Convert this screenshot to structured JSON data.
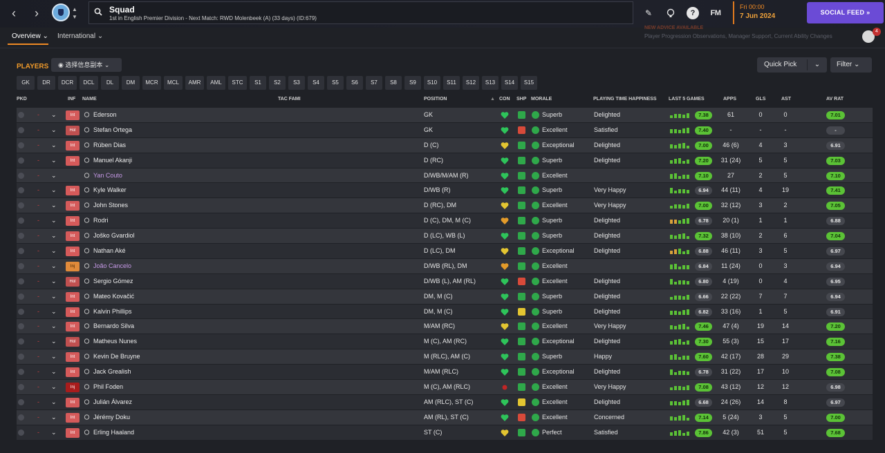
{
  "topbar": {
    "back_label": "‹",
    "forward_label": "›",
    "search_title": "Squad",
    "search_subtitle": "1st in English Premier Division - Next Match: RWD Molenbeek (A) (33 days) (ID:679)",
    "fm_label": "FM",
    "help_label": "?",
    "time": "Fri 00:00",
    "date": "7 Jun 2024",
    "social_feed_label": "SOCIAL FEED »",
    "accent": "#f08a24",
    "social_color": "#6b4bd6"
  },
  "subbar": {
    "tabs": [
      {
        "label": "Overview ⌄"
      },
      {
        "label": "International ⌄"
      }
    ],
    "advice_title": "NEW ADVICE AVAILABLE",
    "advice_line": "Player Progression Observations, Manager Support, Current Ability Changes",
    "advisor_count": "4"
  },
  "players": {
    "label": "PLAYERS",
    "view_label": "◉ 选择信息副本 ⌄",
    "quick_pick_label": "Quick Pick",
    "quick_pick_chevron": "⌄",
    "filter_label": "Filter ⌄",
    "positions": [
      "GK",
      "DR",
      "DCR",
      "DCL",
      "DL",
      "DM",
      "MCR",
      "MCL",
      "AMR",
      "AML",
      "STC",
      "S1",
      "S2",
      "S3",
      "S4",
      "S5",
      "S6",
      "S7",
      "S8",
      "S9",
      "S10",
      "S11",
      "S12",
      "S13",
      "S14",
      "S15"
    ]
  },
  "table": {
    "headers": {
      "pkd": "PKD",
      "inf": "INF",
      "name": "NAME",
      "tac": "TAC FAMI",
      "position": "POSITION",
      "con": "CON",
      "shp": "SHP",
      "morale": "MORALE",
      "pth": "PLAYING TIME HAPPINESS",
      "last5": "LAST 5 GAMES",
      "apps": "APPS",
      "gls": "GLS",
      "ast": "AST",
      "avrat": "AV RAT"
    },
    "rows": [
      {
        "inf": "Int",
        "name": "Ederson",
        "pos": "GK",
        "morale": "Superb",
        "pth": "Delighted",
        "l5": "7.38",
        "apps": "61",
        "gls": "0",
        "ast": "0",
        "av": "7.01"
      },
      {
        "inf": "Hol",
        "name": "Stefan Ortega",
        "pos": "GK",
        "morale": "Excellent",
        "pth": "Satisfied",
        "l5": "7.40",
        "apps": "-",
        "gls": "-",
        "ast": "-",
        "av": "-"
      },
      {
        "inf": "Int",
        "name": "Rúben Dias",
        "pos": "D (C)",
        "morale": "Exceptional",
        "pth": "Delighted",
        "l5": "7.00",
        "apps": "46 (6)",
        "gls": "4",
        "ast": "3",
        "av": "6.91"
      },
      {
        "inf": "Int",
        "name": "Manuel Akanji",
        "pos": "D (RC)",
        "morale": "Superb",
        "pth": "Delighted",
        "l5": "7.20",
        "apps": "31 (24)",
        "gls": "5",
        "ast": "5",
        "av": "7.03"
      },
      {
        "inf": "",
        "name": "Yan Couto",
        "pos": "D/WB/M/AM (R)",
        "morale": "Excellent",
        "pth": "",
        "l5": "7.10",
        "apps": "27",
        "gls": "2",
        "ast": "5",
        "av": "7.10"
      },
      {
        "inf": "Int",
        "name": "Kyle Walker",
        "pos": "D/WB (R)",
        "morale": "Superb",
        "pth": "Very Happy",
        "l5": "6.94",
        "apps": "44 (11)",
        "gls": "4",
        "ast": "19",
        "av": "7.41"
      },
      {
        "inf": "Int",
        "name": "John Stones",
        "pos": "D (RC), DM",
        "morale": "Excellent",
        "pth": "Very Happy",
        "l5": "7.00",
        "apps": "32 (12)",
        "gls": "3",
        "ast": "2",
        "av": "7.05"
      },
      {
        "inf": "Int",
        "name": "Rodri",
        "pos": "D (C), DM, M (C)",
        "morale": "Superb",
        "pth": "Delighted",
        "l5": "6.78",
        "apps": "20 (1)",
        "gls": "1",
        "ast": "1",
        "av": "6.88"
      },
      {
        "inf": "Int",
        "name": "Joško Gvardiol",
        "pos": "D (LC), WB (L)",
        "morale": "Superb",
        "pth": "Delighted",
        "l5": "7.32",
        "apps": "38 (10)",
        "gls": "2",
        "ast": "6",
        "av": "7.04"
      },
      {
        "inf": "Int",
        "name": "Nathan Aké",
        "pos": "D (LC), DM",
        "morale": "Exceptional",
        "pth": "Delighted",
        "l5": "6.88",
        "apps": "46 (11)",
        "gls": "3",
        "ast": "5",
        "av": "6.97"
      },
      {
        "inf": "Inj",
        "name": "João Cancelo",
        "pos": "D/WB (RL), DM",
        "morale": "Excellent",
        "pth": "",
        "l5": "6.84",
        "apps": "11 (24)",
        "gls": "0",
        "ast": "3",
        "av": "6.94"
      },
      {
        "inf": "Hol",
        "name": "Sergio Gómez",
        "pos": "D/WB (L), AM (RL)",
        "morale": "Excellent",
        "pth": "Delighted",
        "l5": "6.80",
        "apps": "4 (19)",
        "gls": "0",
        "ast": "4",
        "av": "6.95"
      },
      {
        "inf": "Int",
        "name": "Mateo Kovačić",
        "pos": "DM, M (C)",
        "morale": "Superb",
        "pth": "Delighted",
        "l5": "6.66",
        "apps": "22 (22)",
        "gls": "7",
        "ast": "7",
        "av": "6.94"
      },
      {
        "inf": "Int",
        "name": "Kalvin Phillips",
        "pos": "DM, M (C)",
        "morale": "Superb",
        "pth": "Delighted",
        "l5": "6.82",
        "apps": "33 (16)",
        "gls": "1",
        "ast": "5",
        "av": "6.91"
      },
      {
        "inf": "Int",
        "name": "Bernardo Silva",
        "pos": "M/AM (RC)",
        "morale": "Excellent",
        "pth": "Very Happy",
        "l5": "7.46",
        "apps": "47 (4)",
        "gls": "19",
        "ast": "14",
        "av": "7.20"
      },
      {
        "inf": "Hol",
        "name": "Matheus Nunes",
        "pos": "M (C), AM (RC)",
        "morale": "Exceptional",
        "pth": "Delighted",
        "l5": "7.30",
        "apps": "55 (3)",
        "gls": "15",
        "ast": "17",
        "av": "7.16"
      },
      {
        "inf": "Int",
        "name": "Kevin De Bruyne",
        "pos": "M (RLC), AM (C)",
        "morale": "Superb",
        "pth": "Happy",
        "l5": "7.60",
        "apps": "42 (17)",
        "gls": "28",
        "ast": "29",
        "av": "7.38"
      },
      {
        "inf": "Int",
        "name": "Jack Grealish",
        "pos": "M/AM (RLC)",
        "morale": "Exceptional",
        "pth": "Delighted",
        "l5": "6.78",
        "apps": "31 (22)",
        "gls": "17",
        "ast": "10",
        "av": "7.08"
      },
      {
        "inf": "Inj",
        "name": "Phil Foden",
        "pos": "M (C), AM (RLC)",
        "morale": "Excellent",
        "pth": "Very Happy",
        "l5": "7.08",
        "apps": "43 (12)",
        "gls": "12",
        "ast": "12",
        "av": "6.98"
      },
      {
        "inf": "Int",
        "name": "Julián Álvarez",
        "pos": "AM (RLC), ST (C)",
        "morale": "Excellent",
        "pth": "Delighted",
        "l5": "6.68",
        "apps": "24 (26)",
        "gls": "14",
        "ast": "8",
        "av": "6.97"
      },
      {
        "inf": "Int",
        "name": "Jérémy Doku",
        "pos": "AM (RL), ST (C)",
        "morale": "Excellent",
        "pth": "Concerned",
        "l5": "7.14",
        "apps": "5 (24)",
        "gls": "3",
        "ast": "5",
        "av": "7.00"
      },
      {
        "inf": "Int",
        "name": "Erling Haaland",
        "pos": "ST (C)",
        "morale": "Perfect",
        "pth": "Satisfied",
        "l5": "7.86",
        "apps": "42 (3)",
        "gls": "51",
        "ast": "5",
        "av": "7.68"
      }
    ]
  },
  "colors": {
    "row_odd": "#34363c",
    "row_even": "#2b2d33",
    "rating_green": "#5bc236",
    "rating_grey": "#45474e",
    "heart_green": "#2ec45a",
    "heart_yellow": "#e3c531",
    "morale_green": "#2fa84a",
    "loan_name": "#c79ae8"
  }
}
